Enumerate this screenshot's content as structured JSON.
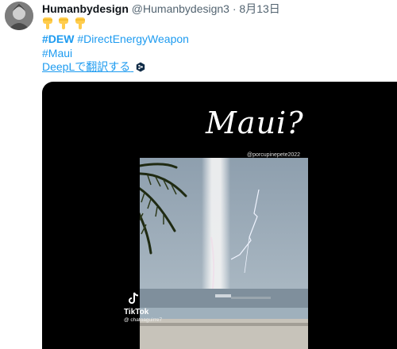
{
  "tweet": {
    "display_name": "Humanbydesign",
    "handle": "@Humanbydesign3",
    "separator": " · ",
    "date": "8月13日",
    "emoji": [
      "point-down",
      "point-down",
      "point-down"
    ],
    "hashtags": [
      "#DEW",
      "#DirectEnergyWeapon",
      "#Maui"
    ],
    "translate_label": "DeepLで翻訳する",
    "translate_icon": "deepl-icon"
  },
  "media": {
    "overlay_title": "Maui?",
    "source_handle": "@porcupinepete2022",
    "platform": "TikTok",
    "platform_user": "@ chatoaguirre7"
  },
  "colors": {
    "link": "#1d9bf0",
    "text": "#0f1419",
    "secondary": "#536471",
    "media_bg": "#000000"
  }
}
